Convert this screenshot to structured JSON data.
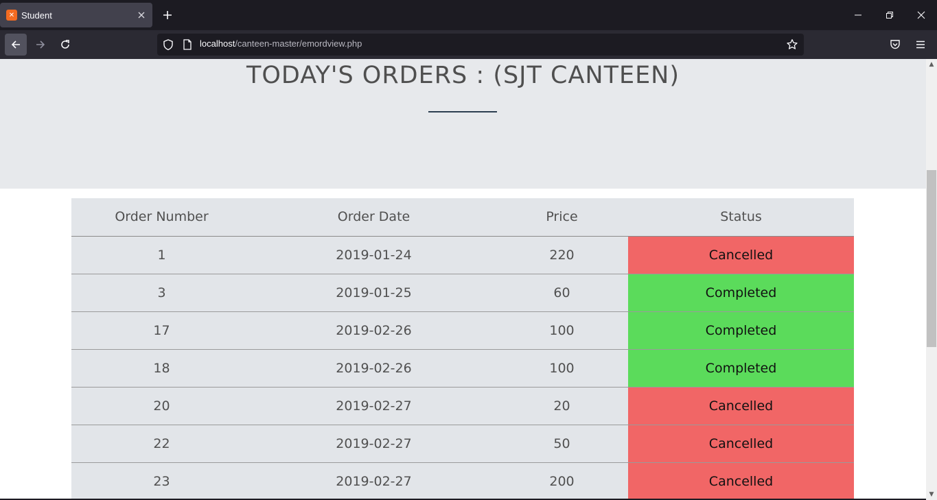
{
  "browser": {
    "tab_title": "Student",
    "tab_favicon_text": "✕",
    "url_host": "localhost",
    "url_path": "/canteen-master/emordview.php",
    "icons": {
      "favicon": "xampp-icon",
      "close_tab": "close-icon",
      "new_tab": "plus-icon",
      "back": "arrow-left-icon",
      "forward": "arrow-right-icon",
      "reload": "reload-icon",
      "tracking": "shield-icon",
      "page": "page-icon",
      "bookmark": "star-icon",
      "pocket": "pocket-icon",
      "menu": "hamburger-icon"
    }
  },
  "page": {
    "title": "TODAY'S ORDERS : (SJT CANTEEN)"
  },
  "table": {
    "headers": {
      "order_number": "Order Number",
      "order_date": "Order Date",
      "price": "Price",
      "status": "Status"
    },
    "rows": [
      {
        "order_number": "1",
        "order_date": "2019-01-24",
        "price": "220",
        "status": "Cancelled"
      },
      {
        "order_number": "3",
        "order_date": "2019-01-25",
        "price": "60",
        "status": "Completed"
      },
      {
        "order_number": "17",
        "order_date": "2019-02-26",
        "price": "100",
        "status": "Completed"
      },
      {
        "order_number": "18",
        "order_date": "2019-02-26",
        "price": "100",
        "status": "Completed"
      },
      {
        "order_number": "20",
        "order_date": "2019-02-27",
        "price": "20",
        "status": "Cancelled"
      },
      {
        "order_number": "22",
        "order_date": "2019-02-27",
        "price": "50",
        "status": "Cancelled"
      },
      {
        "order_number": "23",
        "order_date": "2019-02-27",
        "price": "200",
        "status": "Cancelled"
      }
    ]
  },
  "colors": {
    "cancelled": "#f16666",
    "completed": "#5bdb5b",
    "hero_bg": "#e7e9ec",
    "table_bg": "#e2e5e9"
  }
}
